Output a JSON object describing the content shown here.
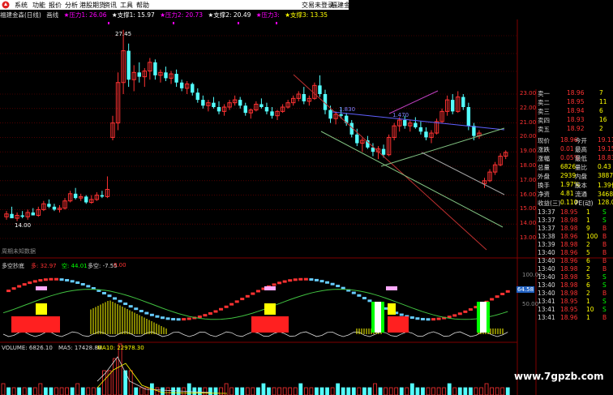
{
  "menu": {
    "items": [
      "系统",
      "功能",
      "报价",
      "分析",
      "港股期货",
      "资讯",
      "工具",
      "帮助"
    ],
    "login": "交易未登录",
    "broker": "福建金森"
  },
  "legend": {
    "title": "福建金森(日线)",
    "adj": "画线",
    "items": [
      {
        "text": "★压力1: 26.06",
        "color": "#ff00ff"
      },
      {
        "text": "★支撑1: 15.97",
        "color": "#ffffff"
      },
      {
        "text": "★压力2: 20.73",
        "color": "#ff00ff"
      },
      {
        "text": "★支撑2: 20.49",
        "color": "#ffffff"
      },
      {
        "text": "★压力3:",
        "color": "#ff00ff"
      },
      {
        "text": "★支撑3: 13.35",
        "color": "#ffff00"
      }
    ]
  },
  "main_chart": {
    "high_label": "27.45",
    "low_label": "14.00",
    "line_label_1": "1.830",
    "line_label_2": "1.470",
    "price_axis": [
      "23.00",
      "22.00",
      "21.00",
      "20.00",
      "19.00",
      "18.00",
      "17.00",
      "16.00",
      "15.00",
      "14.00",
      "13.00"
    ],
    "candles": [
      [
        14.5,
        14.9,
        14.3,
        14.7
      ],
      [
        14.7,
        15.2,
        14.5,
        14.4
      ],
      [
        14.4,
        14.8,
        14.2,
        14.6
      ],
      [
        14.6,
        14.9,
        14.4,
        14.5
      ],
      [
        14.5,
        15.0,
        14.3,
        14.8
      ],
      [
        14.8,
        15.1,
        14.6,
        14.6
      ],
      [
        14.6,
        15.2,
        14.5,
        15.0
      ],
      [
        15.0,
        15.6,
        14.9,
        15.4
      ],
      [
        15.4,
        15.7,
        15.1,
        15.2
      ],
      [
        15.2,
        15.4,
        14.9,
        15.0
      ],
      [
        15.0,
        15.3,
        14.8,
        15.1
      ],
      [
        15.1,
        15.8,
        15.0,
        15.6
      ],
      [
        15.6,
        16.3,
        15.5,
        16.1
      ],
      [
        16.1,
        16.5,
        15.7,
        15.8
      ],
      [
        15.8,
        16.1,
        15.6,
        15.9
      ],
      [
        15.9,
        16.0,
        15.4,
        15.5
      ],
      [
        15.5,
        16.0,
        15.4,
        15.7
      ],
      [
        15.7,
        16.2,
        15.6,
        16.0
      ],
      [
        16.0,
        16.3,
        15.8,
        15.9
      ],
      [
        15.9,
        17.3,
        15.8,
        16.4
      ],
      [
        20.0,
        21.5,
        19.8,
        21.0
      ],
      [
        21.0,
        24.5,
        20.5,
        23.8
      ],
      [
        23.8,
        27.45,
        23.0,
        26.0
      ],
      [
        26.0,
        26.5,
        23.5,
        24.0
      ],
      [
        24.0,
        25.0,
        23.2,
        24.5
      ],
      [
        24.5,
        25.2,
        23.8,
        24.2
      ],
      [
        24.2,
        24.8,
        23.5,
        24.6
      ],
      [
        24.6,
        25.5,
        24.0,
        25.2
      ],
      [
        25.2,
        25.4,
        24.0,
        24.3
      ],
      [
        24.3,
        24.7,
        23.8,
        24.5
      ],
      [
        24.5,
        24.9,
        23.9,
        24.1
      ],
      [
        24.1,
        24.6,
        23.7,
        24.4
      ],
      [
        24.4,
        24.7,
        23.5,
        23.8
      ],
      [
        23.8,
        24.0,
        23.2,
        23.4
      ],
      [
        23.4,
        23.9,
        23.0,
        23.7
      ],
      [
        23.7,
        23.8,
        22.9,
        23.1
      ],
      [
        23.1,
        23.4,
        22.4,
        22.6
      ],
      [
        22.6,
        22.9,
        22.0,
        22.2
      ],
      [
        22.2,
        22.6,
        21.8,
        22.4
      ],
      [
        22.4,
        22.8,
        22.0,
        22.1
      ],
      [
        22.1,
        22.5,
        21.6,
        21.8
      ],
      [
        21.8,
        22.3,
        21.5,
        22.1
      ],
      [
        22.1,
        22.6,
        21.9,
        22.4
      ],
      [
        22.4,
        22.9,
        22.2,
        22.6
      ],
      [
        22.6,
        22.8,
        22.0,
        22.2
      ],
      [
        22.2,
        22.4,
        21.5,
        21.7
      ],
      [
        21.7,
        22.0,
        21.3,
        21.9
      ],
      [
        21.9,
        22.5,
        21.8,
        22.3
      ],
      [
        22.3,
        22.7,
        22.0,
        22.1
      ],
      [
        22.1,
        22.4,
        21.6,
        21.8
      ],
      [
        21.8,
        22.1,
        21.3,
        21.5
      ],
      [
        21.5,
        21.9,
        21.2,
        21.8
      ],
      [
        21.8,
        22.3,
        21.7,
        22.1
      ],
      [
        22.1,
        22.6,
        22.0,
        22.4
      ],
      [
        22.4,
        22.9,
        22.2,
        22.7
      ],
      [
        22.7,
        23.2,
        22.5,
        23.0
      ],
      [
        23.0,
        23.5,
        22.3,
        22.5
      ],
      [
        22.5,
        22.9,
        22.2,
        22.7
      ],
      [
        22.7,
        23.8,
        22.6,
        23.6
      ],
      [
        23.6,
        24.3,
        22.8,
        23.0
      ],
      [
        23.0,
        23.3,
        21.6,
        21.9
      ],
      [
        21.9,
        22.2,
        21.0,
        21.3
      ],
      [
        21.3,
        21.8,
        20.9,
        21.6
      ],
      [
        21.6,
        22.1,
        21.3,
        21.5
      ],
      [
        21.5,
        21.7,
        20.8,
        21.0
      ],
      [
        21.0,
        21.2,
        20.0,
        20.2
      ],
      [
        20.2,
        20.6,
        19.4,
        19.6
      ],
      [
        19.6,
        20.0,
        19.0,
        19.8
      ],
      [
        19.8,
        20.1,
        19.2,
        19.3
      ],
      [
        19.3,
        19.6,
        18.7,
        19.0
      ],
      [
        19.0,
        19.4,
        18.5,
        19.2
      ],
      [
        19.2,
        19.5,
        18.6,
        18.8
      ],
      [
        18.8,
        20.2,
        18.7,
        20.0
      ],
      [
        20.0,
        21.0,
        19.8,
        20.8
      ],
      [
        20.8,
        21.4,
        20.4,
        21.2
      ],
      [
        21.2,
        21.5,
        20.6,
        20.8
      ],
      [
        20.8,
        21.2,
        20.4,
        21.0
      ],
      [
        21.0,
        21.4,
        20.6,
        20.7
      ],
      [
        20.7,
        21.1,
        20.2,
        20.4
      ],
      [
        20.4,
        20.7,
        19.8,
        20.0
      ],
      [
        20.0,
        20.5,
        19.6,
        20.3
      ],
      [
        20.3,
        21.3,
        20.2,
        21.1
      ],
      [
        21.1,
        22.0,
        21.0,
        21.8
      ],
      [
        21.8,
        22.9,
        21.5,
        22.6
      ],
      [
        22.6,
        23.0,
        21.6,
        21.8
      ],
      [
        21.8,
        23.2,
        21.7,
        22.8
      ],
      [
        22.8,
        23.0,
        21.9,
        22.1
      ],
      [
        22.1,
        22.4,
        20.5,
        20.8
      ],
      [
        20.8,
        21.0,
        19.8,
        20.1
      ],
      [
        20.1,
        20.5,
        19.9,
        20.3
      ],
      [
        16.8,
        17.2,
        16.5,
        17.0
      ],
      [
        17.0,
        17.8,
        16.9,
        17.6
      ],
      [
        17.6,
        18.3,
        17.4,
        18.1
      ],
      [
        18.1,
        18.9,
        18.0,
        18.7
      ],
      [
        18.7,
        19.1,
        18.5,
        18.96
      ]
    ]
  },
  "ma_legend": {
    "text": "周期未知数据"
  },
  "indicator": {
    "name": "多空抄底",
    "duo_label": "多: 32.97",
    "kong_label": "空: 44.01",
    "duokong_label": "多空: -7.55",
    "duokong_val": "0.00",
    "axis": [
      "100.00",
      "50.00"
    ],
    "marker_value": "64.58",
    "buy_text": "抄底"
  },
  "volume": {
    "label": "VOLUME: 6826.10",
    "ma5": "MA5: 17428.80",
    "ma10": "MA10: 22978.30"
  },
  "quote": {
    "sells": [
      {
        "name": "卖一",
        "price": "18.96",
        "vol": "7"
      },
      {
        "name": "卖二",
        "price": "18.95",
        "vol": "11"
      },
      {
        "name": "卖三",
        "price": "18.94",
        "vol": "6"
      },
      {
        "name": "卖四",
        "price": "18.93",
        "vol": "16"
      },
      {
        "name": "卖五",
        "price": "18.92",
        "vol": "2"
      }
    ],
    "stats": [
      {
        "k1": "现价",
        "v1": "18.96",
        "k2": "今开",
        "v2": "19.11"
      },
      {
        "k1": "涨跌",
        "v1": "0.01",
        "k2": "最高",
        "v2": "19.15"
      },
      {
        "k1": "涨幅",
        "v1": "0.05%",
        "k2": "最低",
        "v2": "18.83"
      },
      {
        "k1": "总量",
        "v1": "6826",
        "k2": "量比",
        "v2": "0.43"
      },
      {
        "k1": "外盘",
        "v1": "2939",
        "k2": "内盘",
        "v2": "3887"
      },
      {
        "k1": "换手",
        "v1": "1.97%",
        "k2": "股本",
        "v2": "1.39亿"
      },
      {
        "k1": "净资",
        "v1": "4.81",
        "k2": "流通",
        "v2": "3468万"
      },
      {
        "k1": "收益(三)",
        "v1": "0.110",
        "k2": "PE(动)",
        "v2": "128.0"
      }
    ],
    "ticks": [
      {
        "t": "13:37",
        "p": "18.95",
        "v": "1",
        "s": "S"
      },
      {
        "t": "13:37",
        "p": "18.98",
        "v": "1",
        "s": "S"
      },
      {
        "t": "13:37",
        "p": "18.98",
        "v": "9",
        "s": "B"
      },
      {
        "t": "13:38",
        "p": "18.96",
        "v": "100",
        "s": "B"
      },
      {
        "t": "13:39",
        "p": "18.98",
        "v": "2",
        "s": "B"
      },
      {
        "t": "13:40",
        "p": "18.96",
        "v": "5",
        "s": "B"
      },
      {
        "t": "13:40",
        "p": "18.96",
        "v": "6",
        "s": "B"
      },
      {
        "t": "13:40",
        "p": "18.98",
        "v": "2",
        "s": "B"
      },
      {
        "t": "13:40",
        "p": "18.98",
        "v": "5",
        "s": "S"
      },
      {
        "t": "13:40",
        "p": "18.98",
        "v": "6",
        "s": "S"
      },
      {
        "t": "13:40",
        "p": "18.98",
        "v": "2",
        "s": "B"
      },
      {
        "t": "13:41",
        "p": "18.95",
        "v": "1",
        "s": "S"
      },
      {
        "t": "13:41",
        "p": "18.95",
        "v": "10",
        "s": "S"
      },
      {
        "t": "13:41",
        "p": "18.96",
        "v": "1",
        "s": "B"
      }
    ]
  },
  "watermark": "www.7gpzb.com",
  "colors": {
    "up": "#ff3232",
    "down": "#54ffff",
    "grid": "#800000",
    "yellow": "#ffff00",
    "green": "#00ff00"
  }
}
